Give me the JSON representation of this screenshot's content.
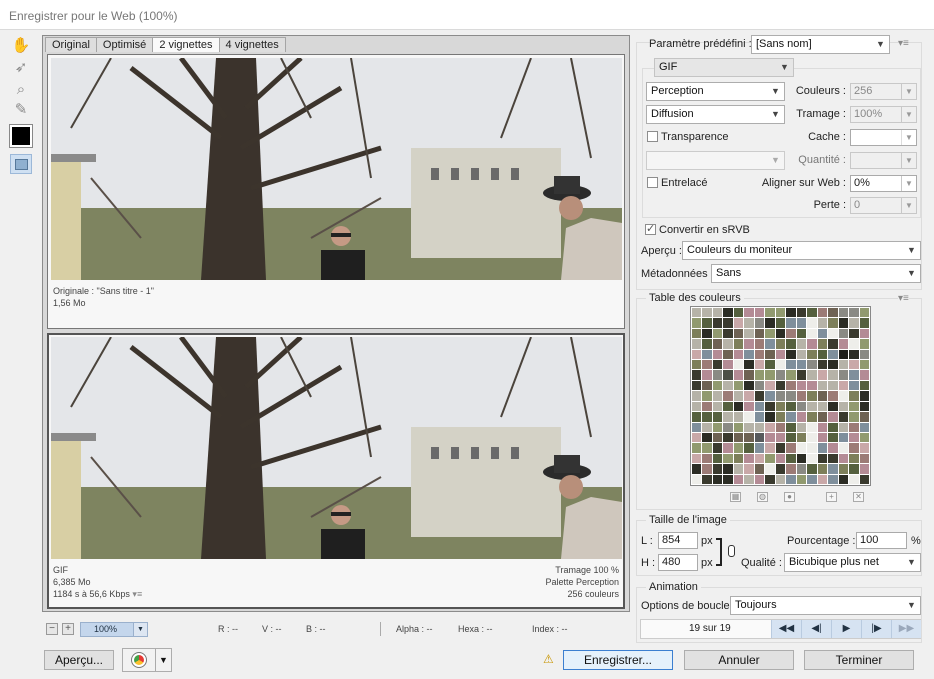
{
  "window": {
    "title": "Enregistrer pour le Web (100%)"
  },
  "tabs": [
    "Original",
    "Optimisé",
    "2 vignettes",
    "4 vignettes"
  ],
  "active_tab": "2 vignettes",
  "original_pane": {
    "name": "Originale : \"Sans titre - 1\"",
    "size": "1,56 Mo"
  },
  "optimized_pane": {
    "format": "GIF",
    "size": "6,385 Mo",
    "time": "1184 s à 56,6 Kbps",
    "dither": "Tramage 100 %",
    "palette": "Palette Perception",
    "colors": "256 couleurs"
  },
  "status": {
    "zoom": "100%",
    "r": "R : --",
    "v": "V : --",
    "b": "B : --",
    "alpha": "Alpha : --",
    "hexa": "Hexa : --",
    "index": "Index : --"
  },
  "bottom_buttons": {
    "apercu": "Aperçu...",
    "enregistrer": "Enregistrer...",
    "annuler": "Annuler",
    "terminer": "Terminer"
  },
  "settings": {
    "preset_label": "Paramètre prédéfini :",
    "preset_value": "[Sans nom]",
    "format": "GIF",
    "reduction": "Perception",
    "dither_algo": "Diffusion",
    "couleurs_label": "Couleurs :",
    "couleurs_value": "256",
    "tramage_label": "Tramage :",
    "tramage_value": "100%",
    "transparence_label": "Transparence",
    "cache_label": "Cache :",
    "quantite_label": "Quantité :",
    "entrelace_label": "Entrelacé",
    "aligner_label": "Aligner sur Web :",
    "aligner_value": "0%",
    "perte_label": "Perte :",
    "perte_value": "0",
    "srgb_label": "Convertir en sRVB",
    "srgb_checked": true,
    "transparence_checked": false,
    "entrelace_checked": false,
    "apercu_label": "Aperçu :",
    "apercu_value": "Couleurs du moniteur",
    "metadonnees_label": "Métadonnées :",
    "metadonnees_value": "Sans"
  },
  "color_table": {
    "title": "Table des couleurs"
  },
  "image_size": {
    "title": "Taille de l'image",
    "l_label": "L :",
    "l_value": "854",
    "l_unit": "px",
    "h_label": "H :",
    "h_value": "480",
    "h_unit": "px",
    "pourcentage_label": "Pourcentage :",
    "pourcentage_value": "100",
    "pourcentage_unit": "%",
    "qualite_label": "Qualité :",
    "qualite_value": "Bicubique plus net"
  },
  "animation": {
    "title": "Animation",
    "boucle_label": "Options de boucle :",
    "boucle_value": "Toujours",
    "frame_counter": "19 sur 19"
  }
}
